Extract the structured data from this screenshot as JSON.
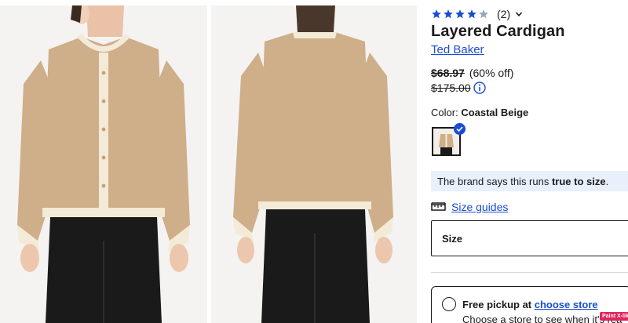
{
  "gallery": {
    "images": [
      {
        "name": "front-view"
      },
      {
        "name": "back-view"
      }
    ]
  },
  "product": {
    "rating": {
      "stars": 4,
      "max": 5,
      "count": "(2)"
    },
    "title": "Layered Cardigan",
    "brand": "Ted Baker",
    "price": {
      "sale": "$68.97",
      "discount": "(60% off)",
      "original": "$175.00"
    },
    "color": {
      "label": "Color:",
      "value": "Coastal Beige"
    },
    "fit_note": {
      "prefix": "The brand says this runs ",
      "emphasis": "true to size",
      "suffix": "."
    },
    "size_guides": "Size guides",
    "size": {
      "label": "Size"
    },
    "pickup": {
      "free_label": "Free pickup at ",
      "choose_store": "choose store",
      "detail": "Choose a store to see when it's rea"
    }
  },
  "extension_badge": "Paint X-like",
  "colors": {
    "accent": "#1a4dd1",
    "star": "#1a4dd1",
    "star_empty": "#9aa6b8",
    "fit_background": "#e8f0fb",
    "cardigan": "#cfae8a",
    "trim": "#f3ead8",
    "pants": "#1a1a1a"
  },
  "icons": [
    "star-icon",
    "chevron-down-icon",
    "info-icon",
    "check-icon",
    "ruler-icon"
  ]
}
